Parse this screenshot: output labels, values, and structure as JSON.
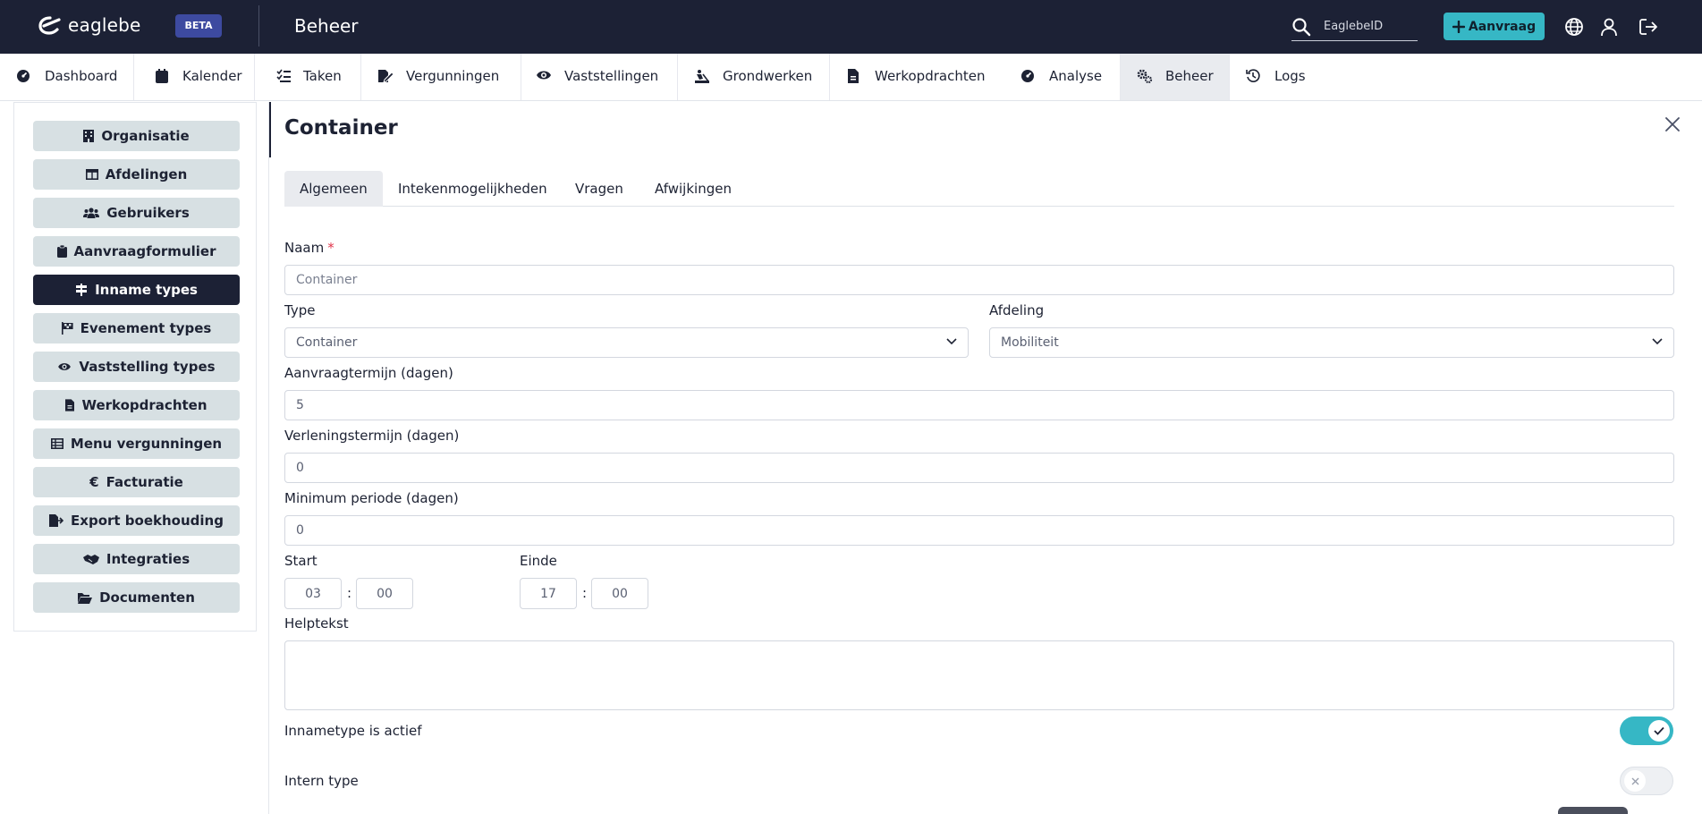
{
  "header": {
    "logo_text": "eaglebe",
    "badge": "BETA",
    "title": "Beheer",
    "search_placeholder": "EaglebeID",
    "add_button_label": "Aanvraag"
  },
  "nav": {
    "items": [
      {
        "label": "Dashboard",
        "icon": "gauge-icon"
      },
      {
        "label": "Kalender",
        "icon": "calendar-icon"
      },
      {
        "label": "Taken",
        "icon": "tasks-icon"
      },
      {
        "label": "Vergunningen",
        "icon": "permit-icon"
      },
      {
        "label": "Vaststellingen",
        "icon": "eye-icon"
      },
      {
        "label": "Grondwerken",
        "icon": "digging-icon"
      },
      {
        "label": "Werkopdrachten",
        "icon": "document-icon"
      },
      {
        "label": "Analyse",
        "icon": "gauge-icon"
      },
      {
        "label": "Beheer",
        "icon": "gears-icon"
      },
      {
        "label": "Logs",
        "icon": "history-icon"
      }
    ],
    "active": "Beheer"
  },
  "sidebar": {
    "items": [
      {
        "label": "Organisatie",
        "icon": "building-icon"
      },
      {
        "label": "Afdelingen",
        "icon": "table-icon"
      },
      {
        "label": "Gebruikers",
        "icon": "users-icon"
      },
      {
        "label": "Aanvraagformulier",
        "icon": "clipboard-icon"
      },
      {
        "label": "Inname types",
        "icon": "signs-icon"
      },
      {
        "label": "Evenement types",
        "icon": "flag-icon"
      },
      {
        "label": "Vaststelling types",
        "icon": "eye-icon"
      },
      {
        "label": "Werkopdrachten",
        "icon": "document-icon"
      },
      {
        "label": "Menu vergunningen",
        "icon": "table-icon"
      },
      {
        "label": "Facturatie",
        "icon": "euro-icon"
      },
      {
        "label": "Export boekhouding",
        "icon": "file-export-icon"
      },
      {
        "label": "Integraties",
        "icon": "handshake-icon"
      },
      {
        "label": "Documenten",
        "icon": "folder-open-icon"
      }
    ],
    "active": "Inname types"
  },
  "panel": {
    "title": "Container",
    "tabs": [
      "Algemeen",
      "Intekenmogelijkheden",
      "Vragen",
      "Afwijkingen"
    ],
    "active_tab": "Algemeen",
    "form": {
      "naam_label": "Naam",
      "required_mark": "*",
      "naam_placeholder": "Container",
      "type_label": "Type",
      "type_value": "Container",
      "afdeling_label": "Afdeling",
      "afdeling_value": "Mobiliteit",
      "aanvraagtermijn_label": "Aanvraagtermijn (dagen)",
      "aanvraagtermijn_value": "5",
      "verleningstermijn_label": "Verleningstermijn (dagen)",
      "verleningstermijn_value": "0",
      "minimum_label": "Minimum periode (dagen)",
      "minimum_value": "0",
      "start_label": "Start",
      "start_hour": "03",
      "start_min": "00",
      "einde_label": "Einde",
      "einde_hour": "17",
      "einde_min": "00",
      "time_sep": ":",
      "helptekst_label": "Helptekst",
      "helptekst_value": "",
      "actief_label": "Innametype is actief",
      "actief": true,
      "intern_label": "Intern type",
      "intern": false
    }
  },
  "colors": {
    "topbar": "#1c2135",
    "accent": "#36b7c5",
    "sidebar_item": "#d7e0e3",
    "active_nav": "#e9ebef",
    "badge": "#3d4aa0"
  }
}
